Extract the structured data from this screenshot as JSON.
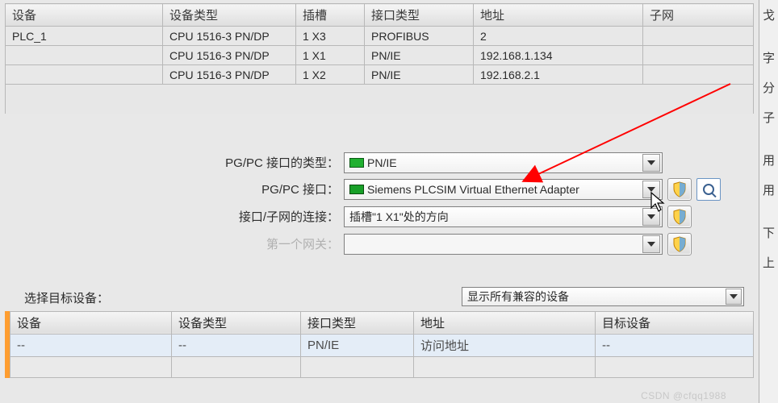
{
  "top_table": {
    "headers": [
      "设备",
      "设备类型",
      "插槽",
      "接口类型",
      "地址",
      "子网"
    ],
    "rows": [
      {
        "c": [
          "PLC_1",
          "CPU 1516-3 PN/DP",
          "1 X3",
          "PROFIBUS",
          "2",
          ""
        ]
      },
      {
        "c": [
          "",
          "CPU 1516-3 PN/DP",
          "1 X1",
          "PN/IE",
          "192.168.1.134",
          ""
        ]
      },
      {
        "c": [
          "",
          "CPU 1516-3 PN/DP",
          "1 X2",
          "PN/IE",
          "192.168.2.1",
          ""
        ]
      }
    ]
  },
  "form": {
    "labels": {
      "type": "PG/PC 接口的类型：",
      "interface": "PG/PC 接口：",
      "subnet": "接口/子网的连接：",
      "gateway": "第一个网关："
    },
    "values": {
      "type": "PN/IE",
      "interface": "Siemens PLCSIM Virtual Ethernet Adapter",
      "subnet": "插槽\"1 X1\"处的方向",
      "gateway": ""
    }
  },
  "lower": {
    "label": "选择目标设备：",
    "filter": "显示所有兼容的设备"
  },
  "bottom_table": {
    "headers": [
      "设备",
      "设备类型",
      "接口类型",
      "地址",
      "目标设备"
    ],
    "rows": [
      {
        "c": [
          "--",
          "--",
          "PN/IE",
          "访问地址",
          "--"
        ]
      }
    ]
  },
  "side": [
    "戈",
    "",
    "字",
    "分",
    "子",
    "",
    "用",
    "用",
    "",
    "下",
    "上"
  ],
  "watermark": "CSDN @cfqq1988"
}
